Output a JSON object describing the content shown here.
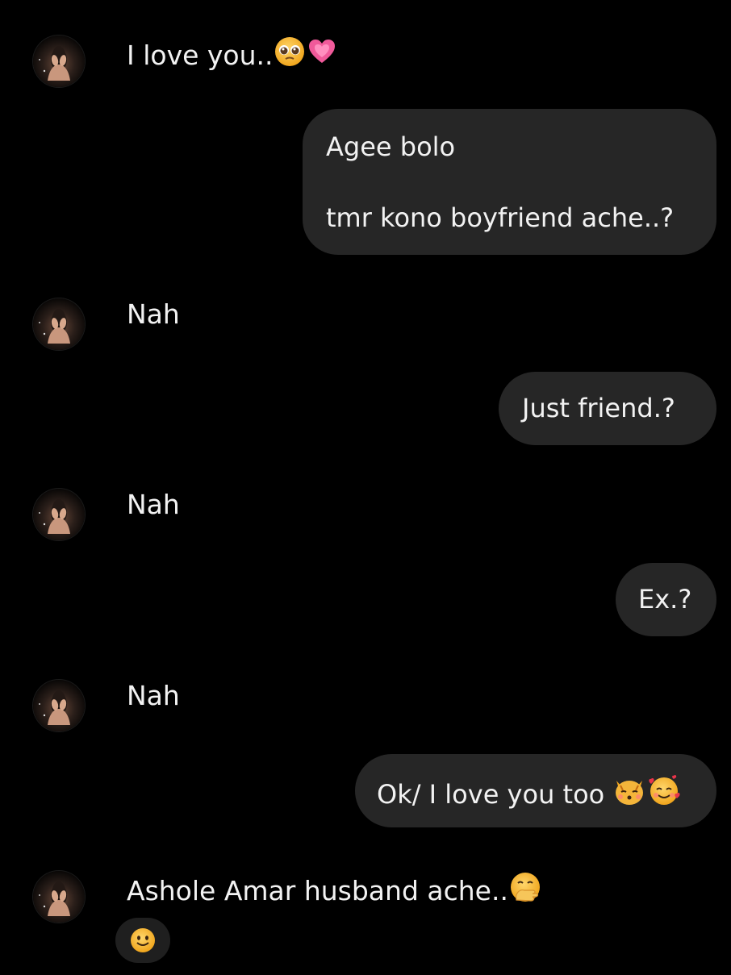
{
  "messages": [
    {
      "from": "them",
      "text": "I love you..",
      "emojis": [
        "pleading-face-emoji",
        "growing-heart-emoji"
      ]
    },
    {
      "from": "me",
      "lines": [
        "Agee bolo",
        "tmr kono boyfriend ache..?"
      ]
    },
    {
      "from": "them",
      "text": "Nah"
    },
    {
      "from": "me",
      "text": "Just friend.?"
    },
    {
      "from": "them",
      "text": "Nah"
    },
    {
      "from": "me",
      "text": "Ex.?"
    },
    {
      "from": "them",
      "text": "Nah"
    },
    {
      "from": "me",
      "text": "Ok/ I love you too",
      "emojis": [
        "kissing-cat-emoji",
        "smiling-face-with-hearts-emoji"
      ]
    },
    {
      "from": "them",
      "text": "Ashole Amar husband ache..",
      "emojis": [
        "face-with-hand-over-mouth-emoji"
      ],
      "reaction": "slightly-smiling-face-emoji"
    }
  ],
  "colors": {
    "background": "#000000",
    "outgoing_bubble": "#262626",
    "text": "#f2f2f2",
    "emoji_yellow": "#f5b82e"
  }
}
